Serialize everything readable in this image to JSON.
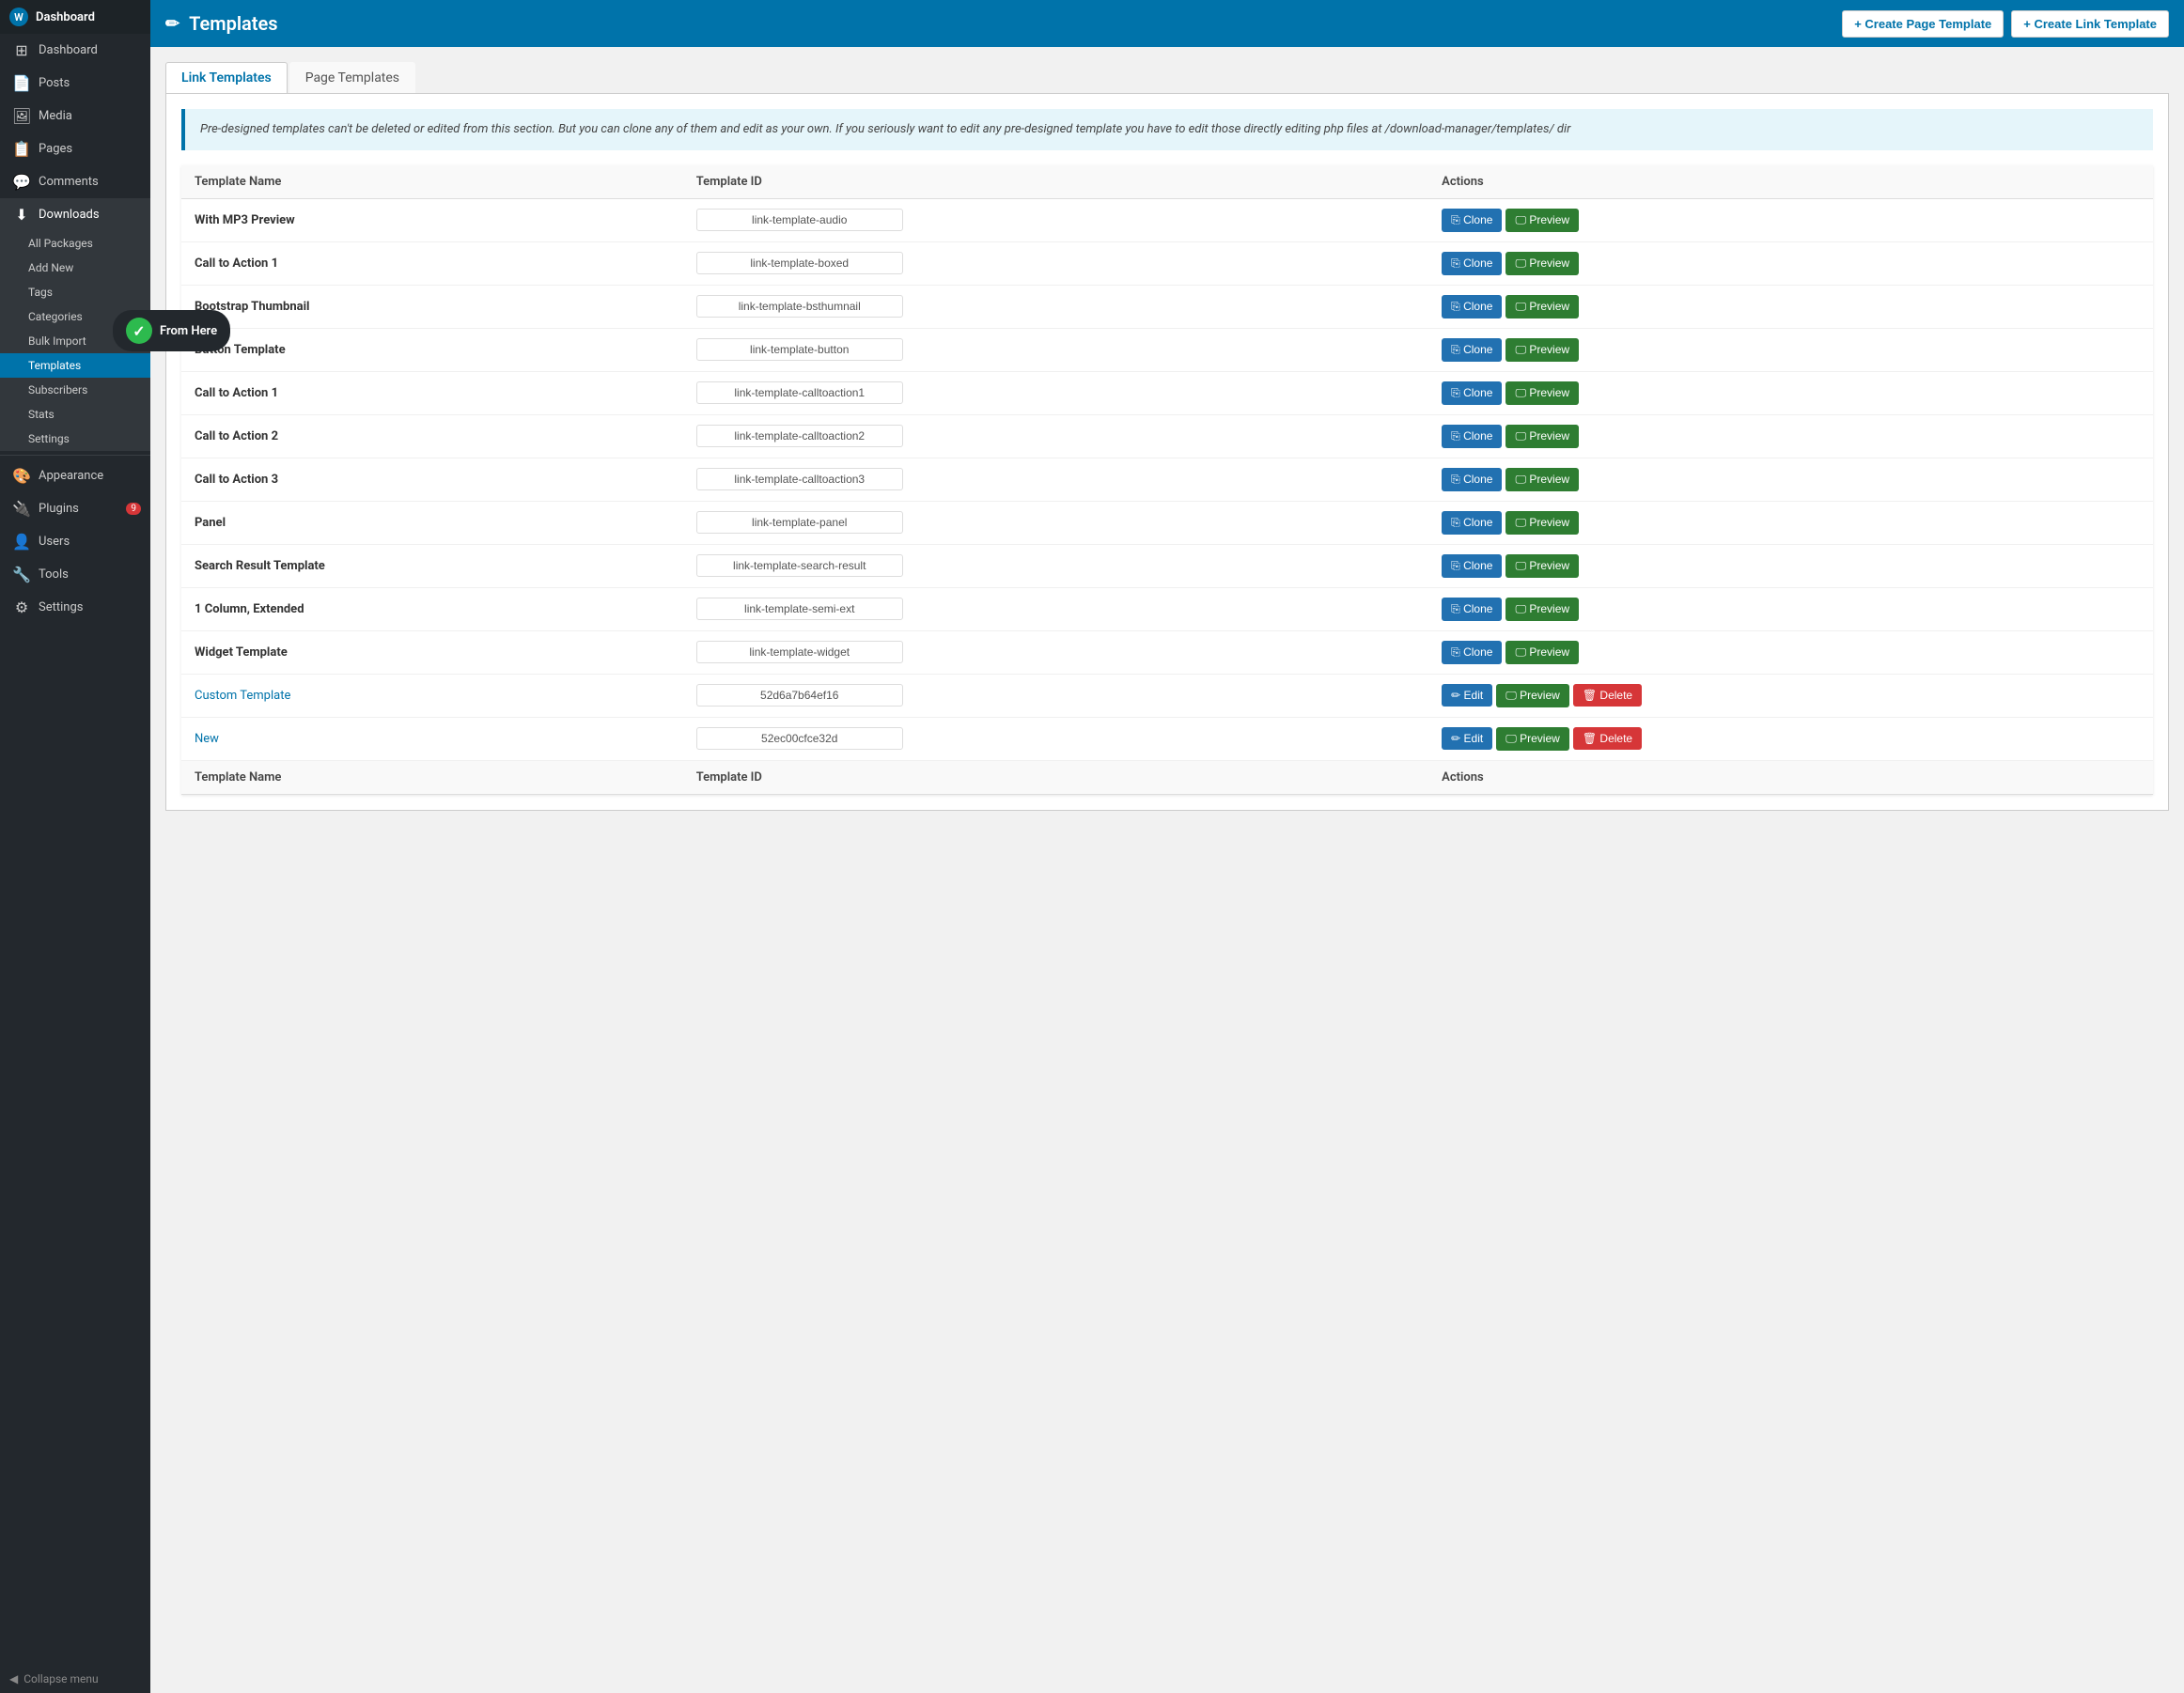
{
  "sidebar": {
    "logo": {
      "label": "Dashboard"
    },
    "items": [
      {
        "id": "dashboard",
        "label": "Dashboard",
        "icon": "⊞"
      },
      {
        "id": "posts",
        "label": "Posts",
        "icon": "📄"
      },
      {
        "id": "media",
        "label": "Media",
        "icon": "🖼"
      },
      {
        "id": "pages",
        "label": "Pages",
        "icon": "📋"
      },
      {
        "id": "comments",
        "label": "Comments",
        "icon": "💬"
      },
      {
        "id": "downloads",
        "label": "Downloads",
        "icon": "⬇",
        "active_parent": true
      },
      {
        "id": "appearance",
        "label": "Appearance",
        "icon": "🎨"
      },
      {
        "id": "plugins",
        "label": "Plugins",
        "icon": "🔌",
        "badge": "9"
      },
      {
        "id": "users",
        "label": "Users",
        "icon": "👤"
      },
      {
        "id": "tools",
        "label": "Tools",
        "icon": "🔧"
      },
      {
        "id": "settings",
        "label": "Settings",
        "icon": "⚙"
      }
    ],
    "submenu": [
      {
        "id": "all-packages",
        "label": "All Packages"
      },
      {
        "id": "add-new",
        "label": "Add New"
      },
      {
        "id": "tags",
        "label": "Tags"
      },
      {
        "id": "categories",
        "label": "Categories"
      },
      {
        "id": "bulk-import",
        "label": "Bulk Import"
      },
      {
        "id": "templates",
        "label": "Templates",
        "active": true
      },
      {
        "id": "subscribers",
        "label": "Subscribers"
      },
      {
        "id": "stats",
        "label": "Stats"
      },
      {
        "id": "settings-sub",
        "label": "Settings"
      }
    ],
    "collapse_label": "Collapse menu"
  },
  "header": {
    "icon": "✏",
    "title": "Templates",
    "create_page_label": "+ Create Page Template",
    "create_link_label": "+ Create Link Template"
  },
  "tabs": [
    {
      "id": "link-templates",
      "label": "Link Templates",
      "active": true
    },
    {
      "id": "page-templates",
      "label": "Page Templates"
    }
  ],
  "notice": "Pre-designed templates can't be deleted or edited from this section. But you can clone any of them and edit as your own. If you seriously want to edit any pre-designed template you have to edit those directly editing php files at /download-manager/templates/ dir",
  "table": {
    "columns": [
      {
        "id": "name",
        "label": "Template Name"
      },
      {
        "id": "template_id",
        "label": "Template ID"
      },
      {
        "id": "actions",
        "label": "Actions"
      }
    ],
    "rows": [
      {
        "name": "With MP3 Preview",
        "template_id": "link-template-audio",
        "type": "predesigned"
      },
      {
        "name": "Call to Action 1",
        "template_id": "link-template-boxed",
        "type": "predesigned"
      },
      {
        "name": "Bootstrap Thumbnail",
        "template_id": "link-template-bsthumnail",
        "type": "predesigned"
      },
      {
        "name": "Button Template",
        "template_id": "link-template-button",
        "type": "predesigned"
      },
      {
        "name": "Call to Action 1",
        "template_id": "link-template-calltoaction1",
        "type": "predesigned"
      },
      {
        "name": "Call to Action 2",
        "template_id": "link-template-calltoaction2",
        "type": "predesigned"
      },
      {
        "name": "Call to Action 3",
        "template_id": "link-template-calltoaction3",
        "type": "predesigned"
      },
      {
        "name": "Panel",
        "template_id": "link-template-panel",
        "type": "predesigned"
      },
      {
        "name": "Search Result Template",
        "template_id": "link-template-search-result",
        "type": "predesigned"
      },
      {
        "name": "1 Column, Extended",
        "template_id": "link-template-semi-ext",
        "type": "predesigned"
      },
      {
        "name": "Widget Template",
        "template_id": "link-template-widget",
        "type": "predesigned"
      },
      {
        "name": "Custom Template",
        "template_id": "52d6a7b64ef16",
        "type": "custom"
      },
      {
        "name": "New",
        "template_id": "52ec00cfce32d",
        "type": "custom"
      }
    ],
    "footer_columns": [
      {
        "label": "Template Name"
      },
      {
        "label": "Template ID"
      },
      {
        "label": "Actions"
      }
    ]
  },
  "tooltip": {
    "check_icon": "✓",
    "label": "From Here"
  },
  "buttons": {
    "clone": "Clone",
    "preview": "Preview",
    "edit": "Edit",
    "delete": "Delete"
  }
}
